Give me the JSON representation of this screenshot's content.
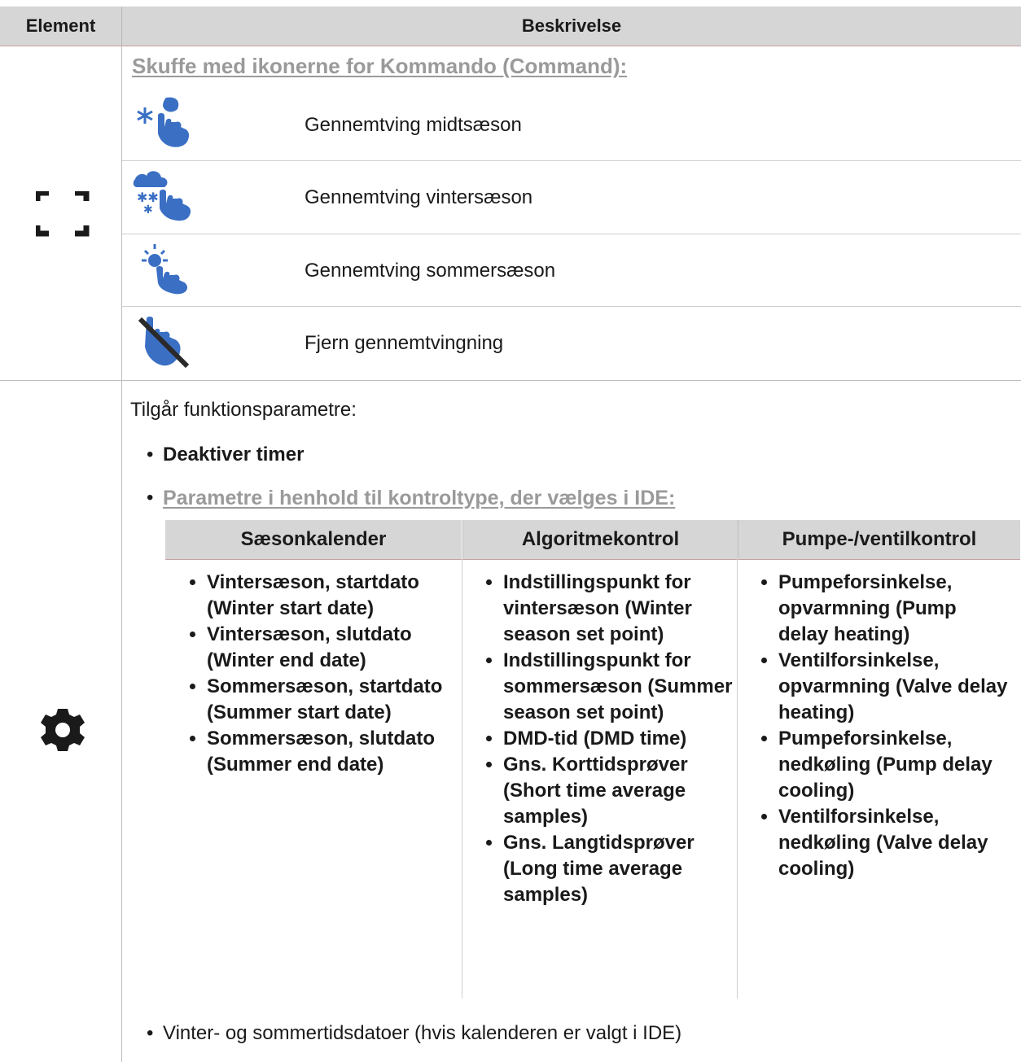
{
  "header": {
    "element": "Element",
    "description": "Beskrivelse"
  },
  "row1": {
    "subtitle": "Skuffe med ikonerne for Kommando (Command):",
    "items": [
      {
        "icon": "force-midseason-icon",
        "label": "Gennemtving midtsæson"
      },
      {
        "icon": "force-winter-icon",
        "label": "Gennemtving vintersæson"
      },
      {
        "icon": "force-summer-icon",
        "label": "Gennemtving sommersæson"
      },
      {
        "icon": "remove-force-icon",
        "label": "Fjern gennemtvingning"
      }
    ],
    "element_icon": "expand-corners-icon"
  },
  "row2": {
    "element_icon": "gear-icon",
    "intro": "Tilgår funktionsparametre:",
    "bullet1": "Deaktiver timer",
    "bullet2": "Parametre i henhold til kontroltype, der vælges i IDE:",
    "table": {
      "headers": [
        "Sæsonkalender",
        "Algoritmekontrol",
        "Pumpe-/ventilkontrol"
      ],
      "col1": [
        "Vintersæson, startdato (Winter start date)",
        "Vintersæson, slutdato (Winter end date)",
        "Sommersæson, startdato (Summer start date)",
        "Sommersæson, slutdato (Summer end date)"
      ],
      "col2": [
        "Indstillingspunkt for vintersæson (Winter season set point)",
        "Indstillingspunkt for sommersæson (Summer season set point)",
        "DMD-tid (DMD time)",
        "Gns. Korttidsprøver (Short time average samples)",
        "Gns. Langtidsprøver (Long time average samples)"
      ],
      "col3": [
        "Pumpeforsinkelse, opvarmning (Pump delay heating)",
        "Ventilforsinkelse, opvarmning (Valve delay heating)",
        "Pumpeforsinkelse, nedkøling (Pump delay cooling)",
        "Ventilforsinkelse, nedkøling (Valve delay cooling)"
      ]
    },
    "bullet3": "Vinter- og sommertidsdatoer (hvis kalenderen er valgt i IDE)"
  },
  "colors": {
    "header_bg": "#d6d6d6",
    "icon_blue": "#3a6fc4",
    "muted_text": "#9a9a9a"
  }
}
